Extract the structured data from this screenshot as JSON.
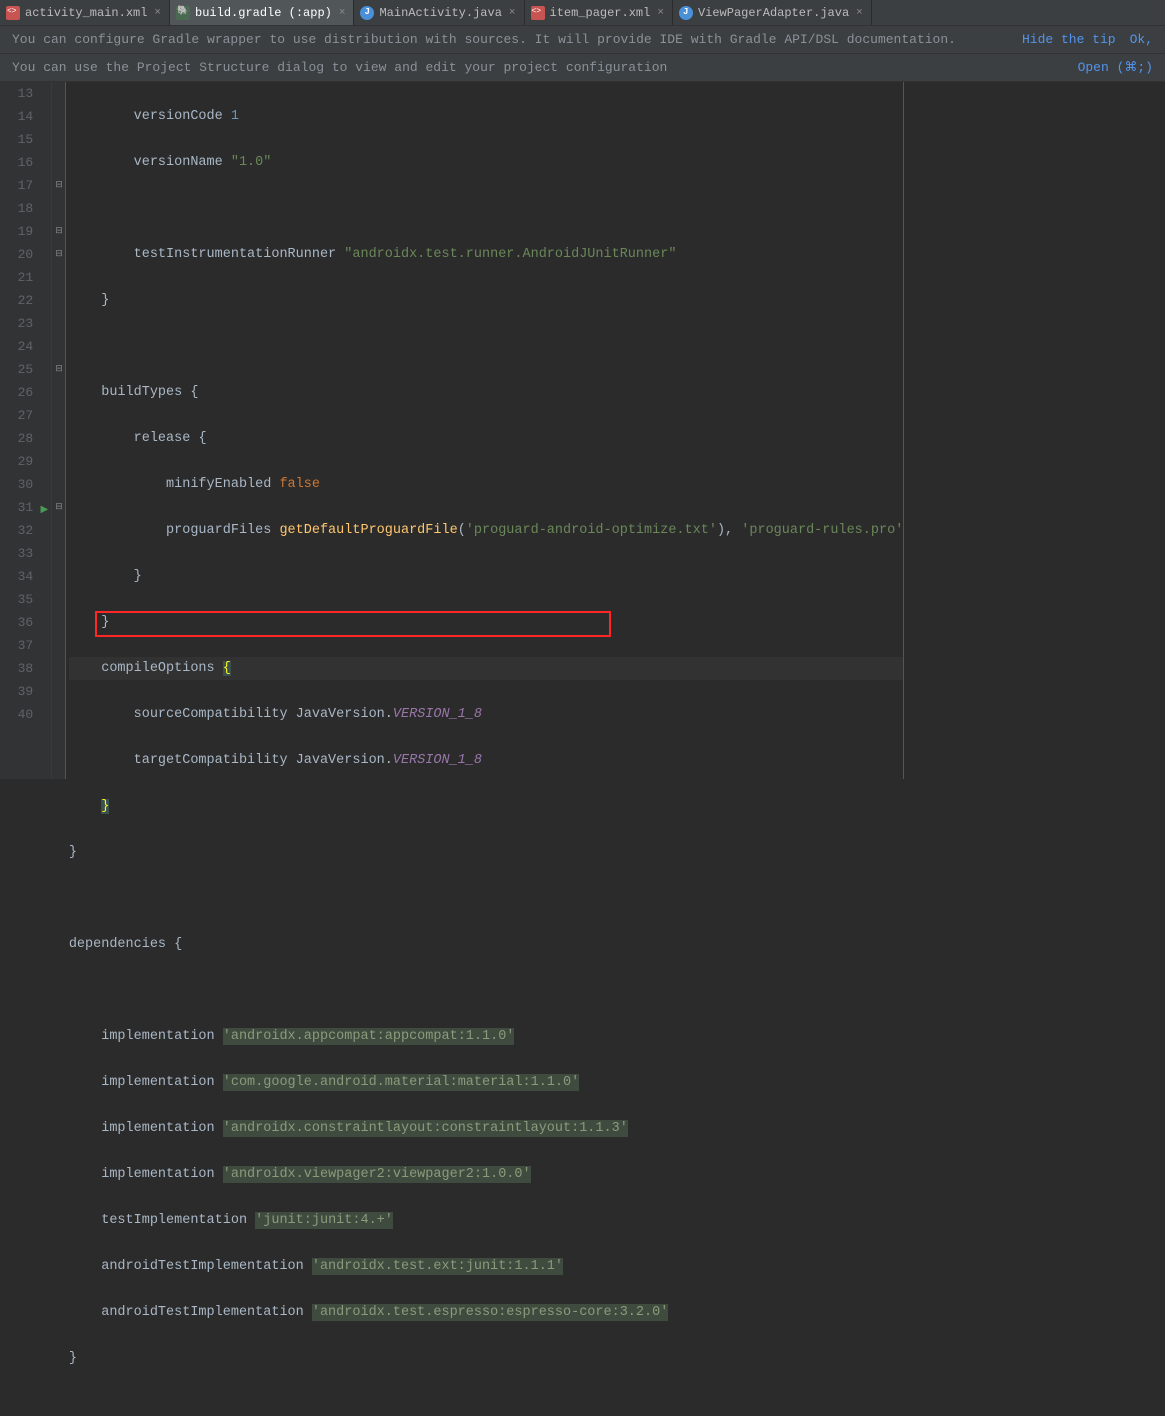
{
  "tabs": [
    {
      "label": "activity_main.xml",
      "icon": "xml"
    },
    {
      "label": "build.gradle (:app)",
      "icon": "gradle",
      "active": true
    },
    {
      "label": "MainActivity.java",
      "icon": "java"
    },
    {
      "label": "item_pager.xml",
      "icon": "xml"
    },
    {
      "label": "ViewPagerAdapter.java",
      "icon": "java"
    }
  ],
  "banner1": {
    "text": "You can configure Gradle wrapper to use distribution with sources. It will provide IDE with Gradle API/DSL documentation.",
    "link1": "Hide the tip",
    "link2": "Ok,"
  },
  "banner2": {
    "text": "You can use the Project Structure dialog to view and edit your project configuration",
    "link1": "Open (⌘;)"
  },
  "lines": {
    "start": 13,
    "end": 40,
    "l13_a": "versionCode ",
    "l13_b": "1",
    "l14_a": "versionName ",
    "l14_b": "\"1.0\"",
    "l16_a": "testInstrumentationRunner ",
    "l16_b": "\"androidx.test.runner.AndroidJUnitRunner\"",
    "l17": "}",
    "l19_a": "buildTypes ",
    "l19_b": "{",
    "l20_a": "release ",
    "l20_b": "{",
    "l21_a": "minifyEnabled ",
    "l21_b": "false",
    "l22_a": "proguardFiles ",
    "l22_b": "getDefaultProguardFile",
    "l22_c": "(",
    "l22_d": "'proguard-android-optimize.txt'",
    "l22_e": "), ",
    "l22_f": "'proguard-rules.pro'",
    "l23": "}",
    "l24": "}",
    "l25_a": "compileOptions ",
    "l25_b": "{",
    "l26_a": "sourceCompatibility JavaVersion.",
    "l26_b": "VERSION_1_8",
    "l27_a": "targetCompatibility JavaVersion.",
    "l27_b": "VERSION_1_8",
    "l28": "}",
    "l29": "}",
    "l31_a": "dependencies ",
    "l31_b": "{",
    "l33_a": "implementation ",
    "l33_b": "'androidx.appcompat:appcompat:1.1.0'",
    "l34_a": "implementation ",
    "l34_b": "'com.google.android.material:material:1.1.0'",
    "l35_a": "implementation ",
    "l35_b": "'androidx.constraintlayout:constraintlayout:1.1.3'",
    "l36_a": "implementation ",
    "l36_b": "'androidx.viewpager2:viewpager2:1.0.0'",
    "l37_a": "testImplementation ",
    "l37_b": "'junit:junit:4.+'",
    "l38_a": "androidTestImplementation ",
    "l38_b": "'androidx.test.ext:junit:1.1.1'",
    "l39_a": "androidTestImplementation ",
    "l39_b": "'androidx.test.espresso:espresso-core:3.2.0'",
    "l40": "}"
  }
}
